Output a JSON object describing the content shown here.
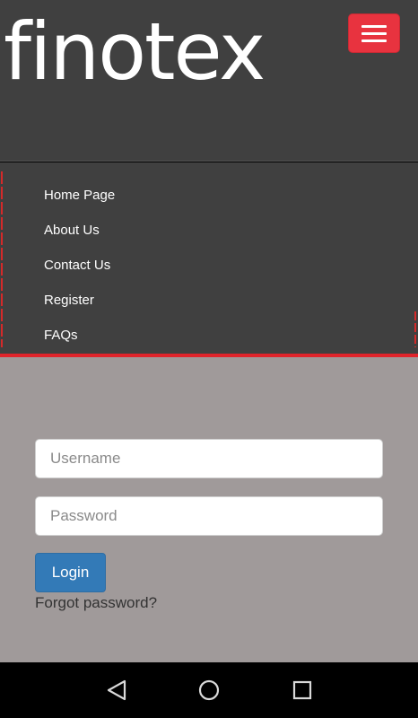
{
  "header": {
    "logo_text": "finotex",
    "menu_icon": "hamburger-menu-icon",
    "menu_button_color": "#e8333f"
  },
  "nav": {
    "items": [
      {
        "label": "Home Page"
      },
      {
        "label": "About Us"
      },
      {
        "label": "Contact Us"
      },
      {
        "label": "Register"
      },
      {
        "label": "FAQs"
      }
    ],
    "accent_color": "#e0242b"
  },
  "login_form": {
    "username_placeholder": "Username",
    "username_value": "",
    "password_placeholder": "Password",
    "password_value": "",
    "login_label": "Login",
    "forgot_label": "Forgot password?",
    "button_color": "#337ab7"
  },
  "system_bar": {
    "back_icon": "back-triangle-icon",
    "home_icon": "home-circle-icon",
    "recent_icon": "recent-apps-square-icon"
  }
}
